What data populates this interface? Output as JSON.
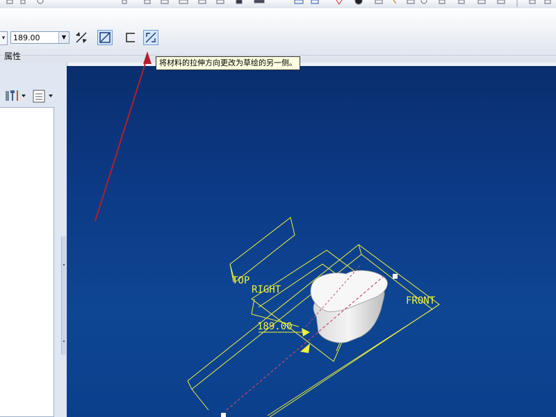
{
  "dashboard": {
    "depth_value": "189.00",
    "properties_tab": "属性"
  },
  "tooltip": {
    "text": "将材料的拉伸方向更改为草绘的另一侧。"
  },
  "viewport": {
    "datum_labels": [
      "TOP",
      "RIGHT",
      "FRONT"
    ],
    "dimension_value": "189.00",
    "background_color": "#0c3a86",
    "datum_color": "#f2f23a"
  },
  "annotation": {
    "arrow_color": "#b21f2a"
  }
}
